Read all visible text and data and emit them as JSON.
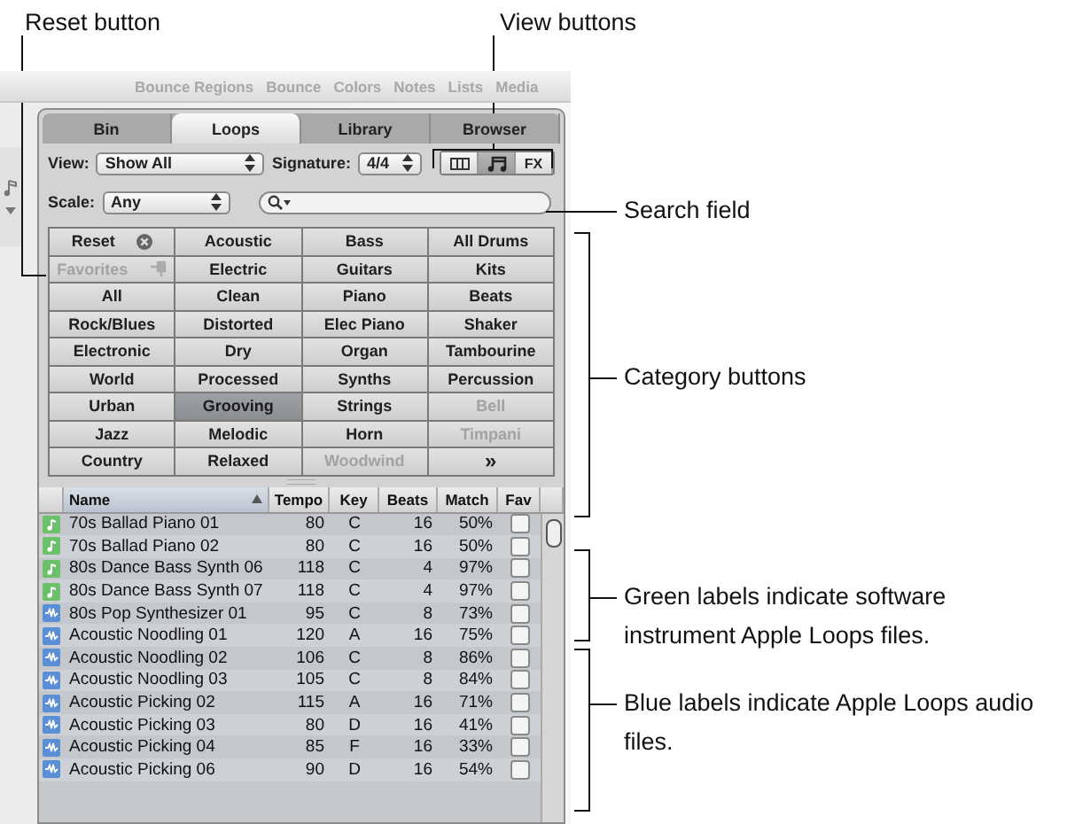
{
  "annotations": [
    {
      "kind": "reset",
      "text": "Reset button"
    },
    {
      "kind": "view",
      "text": "View buttons"
    },
    {
      "kind": "search",
      "text": "Search field"
    },
    {
      "kind": "category",
      "text": "Category buttons"
    },
    {
      "kind": "green",
      "text": "Green labels indicate software instrument Apple Loops files."
    },
    {
      "kind": "blue",
      "text": "Blue labels indicate Apple Loops audio files."
    }
  ],
  "toolbar": {
    "items": [
      "Bounce Regions",
      "Bounce",
      "Colors",
      "Notes",
      "Lists",
      "Media"
    ]
  },
  "tabs": [
    {
      "label": "Bin",
      "selected": false
    },
    {
      "label": "Loops",
      "selected": true
    },
    {
      "label": "Library",
      "selected": false
    },
    {
      "label": "Browser",
      "selected": false
    }
  ],
  "view": {
    "label": "View:",
    "value": "Show All"
  },
  "signature": {
    "label": "Signature:",
    "value": "4/4"
  },
  "view_buttons": [
    {
      "kind": "columns",
      "selected": false
    },
    {
      "kind": "note",
      "selected": true
    },
    {
      "kind": "text",
      "label": "FX",
      "selected": false
    }
  ],
  "scale": {
    "label": "Scale:",
    "value": "Any"
  },
  "categories": [
    {
      "label": "Reset",
      "kind": "reset",
      "selected": false,
      "disabled": false
    },
    {
      "label": "Acoustic",
      "kind": "plain",
      "selected": false,
      "disabled": false
    },
    {
      "label": "Bass",
      "kind": "plain",
      "selected": false,
      "disabled": false
    },
    {
      "label": "All Drums",
      "kind": "plain",
      "selected": false,
      "disabled": false
    },
    {
      "label": "Favorites",
      "kind": "favorites",
      "selected": false,
      "disabled": true
    },
    {
      "label": "Electric",
      "kind": "plain",
      "selected": false,
      "disabled": false
    },
    {
      "label": "Guitars",
      "kind": "plain",
      "selected": false,
      "disabled": false
    },
    {
      "label": "Kits",
      "kind": "plain",
      "selected": false,
      "disabled": false
    },
    {
      "label": "All",
      "kind": "plain",
      "selected": false,
      "disabled": false
    },
    {
      "label": "Clean",
      "kind": "plain",
      "selected": false,
      "disabled": false
    },
    {
      "label": "Piano",
      "kind": "plain",
      "selected": false,
      "disabled": false
    },
    {
      "label": "Beats",
      "kind": "plain",
      "selected": false,
      "disabled": false
    },
    {
      "label": "Rock/Blues",
      "kind": "plain",
      "selected": false,
      "disabled": false
    },
    {
      "label": "Distorted",
      "kind": "plain",
      "selected": false,
      "disabled": false
    },
    {
      "label": "Elec Piano",
      "kind": "plain",
      "selected": false,
      "disabled": false
    },
    {
      "label": "Shaker",
      "kind": "plain",
      "selected": false,
      "disabled": false
    },
    {
      "label": "Electronic",
      "kind": "plain",
      "selected": false,
      "disabled": false
    },
    {
      "label": "Dry",
      "kind": "plain",
      "selected": false,
      "disabled": false
    },
    {
      "label": "Organ",
      "kind": "plain",
      "selected": false,
      "disabled": false
    },
    {
      "label": "Tambourine",
      "kind": "plain",
      "selected": false,
      "disabled": false
    },
    {
      "label": "World",
      "kind": "plain",
      "selected": false,
      "disabled": false
    },
    {
      "label": "Processed",
      "kind": "plain",
      "selected": false,
      "disabled": false
    },
    {
      "label": "Synths",
      "kind": "plain",
      "selected": false,
      "disabled": false
    },
    {
      "label": "Percussion",
      "kind": "plain",
      "selected": false,
      "disabled": false
    },
    {
      "label": "Urban",
      "kind": "plain",
      "selected": false,
      "disabled": false
    },
    {
      "label": "Grooving",
      "kind": "plain",
      "selected": true,
      "disabled": false
    },
    {
      "label": "Strings",
      "kind": "plain",
      "selected": false,
      "disabled": false
    },
    {
      "label": "Bell",
      "kind": "plain",
      "selected": false,
      "disabled": true
    },
    {
      "label": "Jazz",
      "kind": "plain",
      "selected": false,
      "disabled": false
    },
    {
      "label": "Melodic",
      "kind": "plain",
      "selected": false,
      "disabled": false
    },
    {
      "label": "Horn",
      "kind": "plain",
      "selected": false,
      "disabled": false
    },
    {
      "label": "Timpani",
      "kind": "plain",
      "selected": false,
      "disabled": true
    },
    {
      "label": "Country",
      "kind": "plain",
      "selected": false,
      "disabled": false
    },
    {
      "label": "Relaxed",
      "kind": "plain",
      "selected": false,
      "disabled": false
    },
    {
      "label": "Woodwind",
      "kind": "plain",
      "selected": false,
      "disabled": true
    },
    {
      "label": "»",
      "kind": "more",
      "selected": false,
      "disabled": false
    }
  ],
  "table": {
    "columns": [
      {
        "label": "Name",
        "sorted": true
      },
      {
        "label": "Tempo",
        "sorted": false
      },
      {
        "label": "Key",
        "sorted": false
      },
      {
        "label": "Beats",
        "sorted": false
      },
      {
        "label": "Match",
        "sorted": false
      },
      {
        "label": "Fav",
        "sorted": false
      }
    ],
    "rows": [
      {
        "kind": "software",
        "name": "70s Ballad Piano 01",
        "tempo": "80",
        "key": "C",
        "beats": "16",
        "match": "50%",
        "fav": false
      },
      {
        "kind": "software",
        "name": "70s Ballad Piano 02",
        "tempo": "80",
        "key": "C",
        "beats": "16",
        "match": "50%",
        "fav": false
      },
      {
        "kind": "software",
        "name": "80s Dance Bass Synth 06",
        "tempo": "118",
        "key": "C",
        "beats": "4",
        "match": "97%",
        "fav": false
      },
      {
        "kind": "software",
        "name": "80s Dance Bass Synth 07",
        "tempo": "118",
        "key": "C",
        "beats": "4",
        "match": "97%",
        "fav": false
      },
      {
        "kind": "audio",
        "name": "80s Pop Synthesizer 01",
        "tempo": "95",
        "key": "C",
        "beats": "8",
        "match": "73%",
        "fav": false
      },
      {
        "kind": "audio",
        "name": "Acoustic Noodling 01",
        "tempo": "120",
        "key": "A",
        "beats": "16",
        "match": "75%",
        "fav": false
      },
      {
        "kind": "audio",
        "name": "Acoustic Noodling 02",
        "tempo": "106",
        "key": "C",
        "beats": "8",
        "match": "86%",
        "fav": false
      },
      {
        "kind": "audio",
        "name": "Acoustic Noodling 03",
        "tempo": "105",
        "key": "C",
        "beats": "8",
        "match": "84%",
        "fav": false
      },
      {
        "kind": "audio",
        "name": "Acoustic Picking 02",
        "tempo": "115",
        "key": "A",
        "beats": "16",
        "match": "71%",
        "fav": false
      },
      {
        "kind": "audio",
        "name": "Acoustic Picking 03",
        "tempo": "80",
        "key": "D",
        "beats": "16",
        "match": "41%",
        "fav": false
      },
      {
        "kind": "audio",
        "name": "Acoustic Picking 04",
        "tempo": "85",
        "key": "F",
        "beats": "16",
        "match": "33%",
        "fav": false
      },
      {
        "kind": "audio",
        "name": "Acoustic Picking 06",
        "tempo": "90",
        "key": "D",
        "beats": "16",
        "match": "54%",
        "fav": false
      }
    ]
  }
}
